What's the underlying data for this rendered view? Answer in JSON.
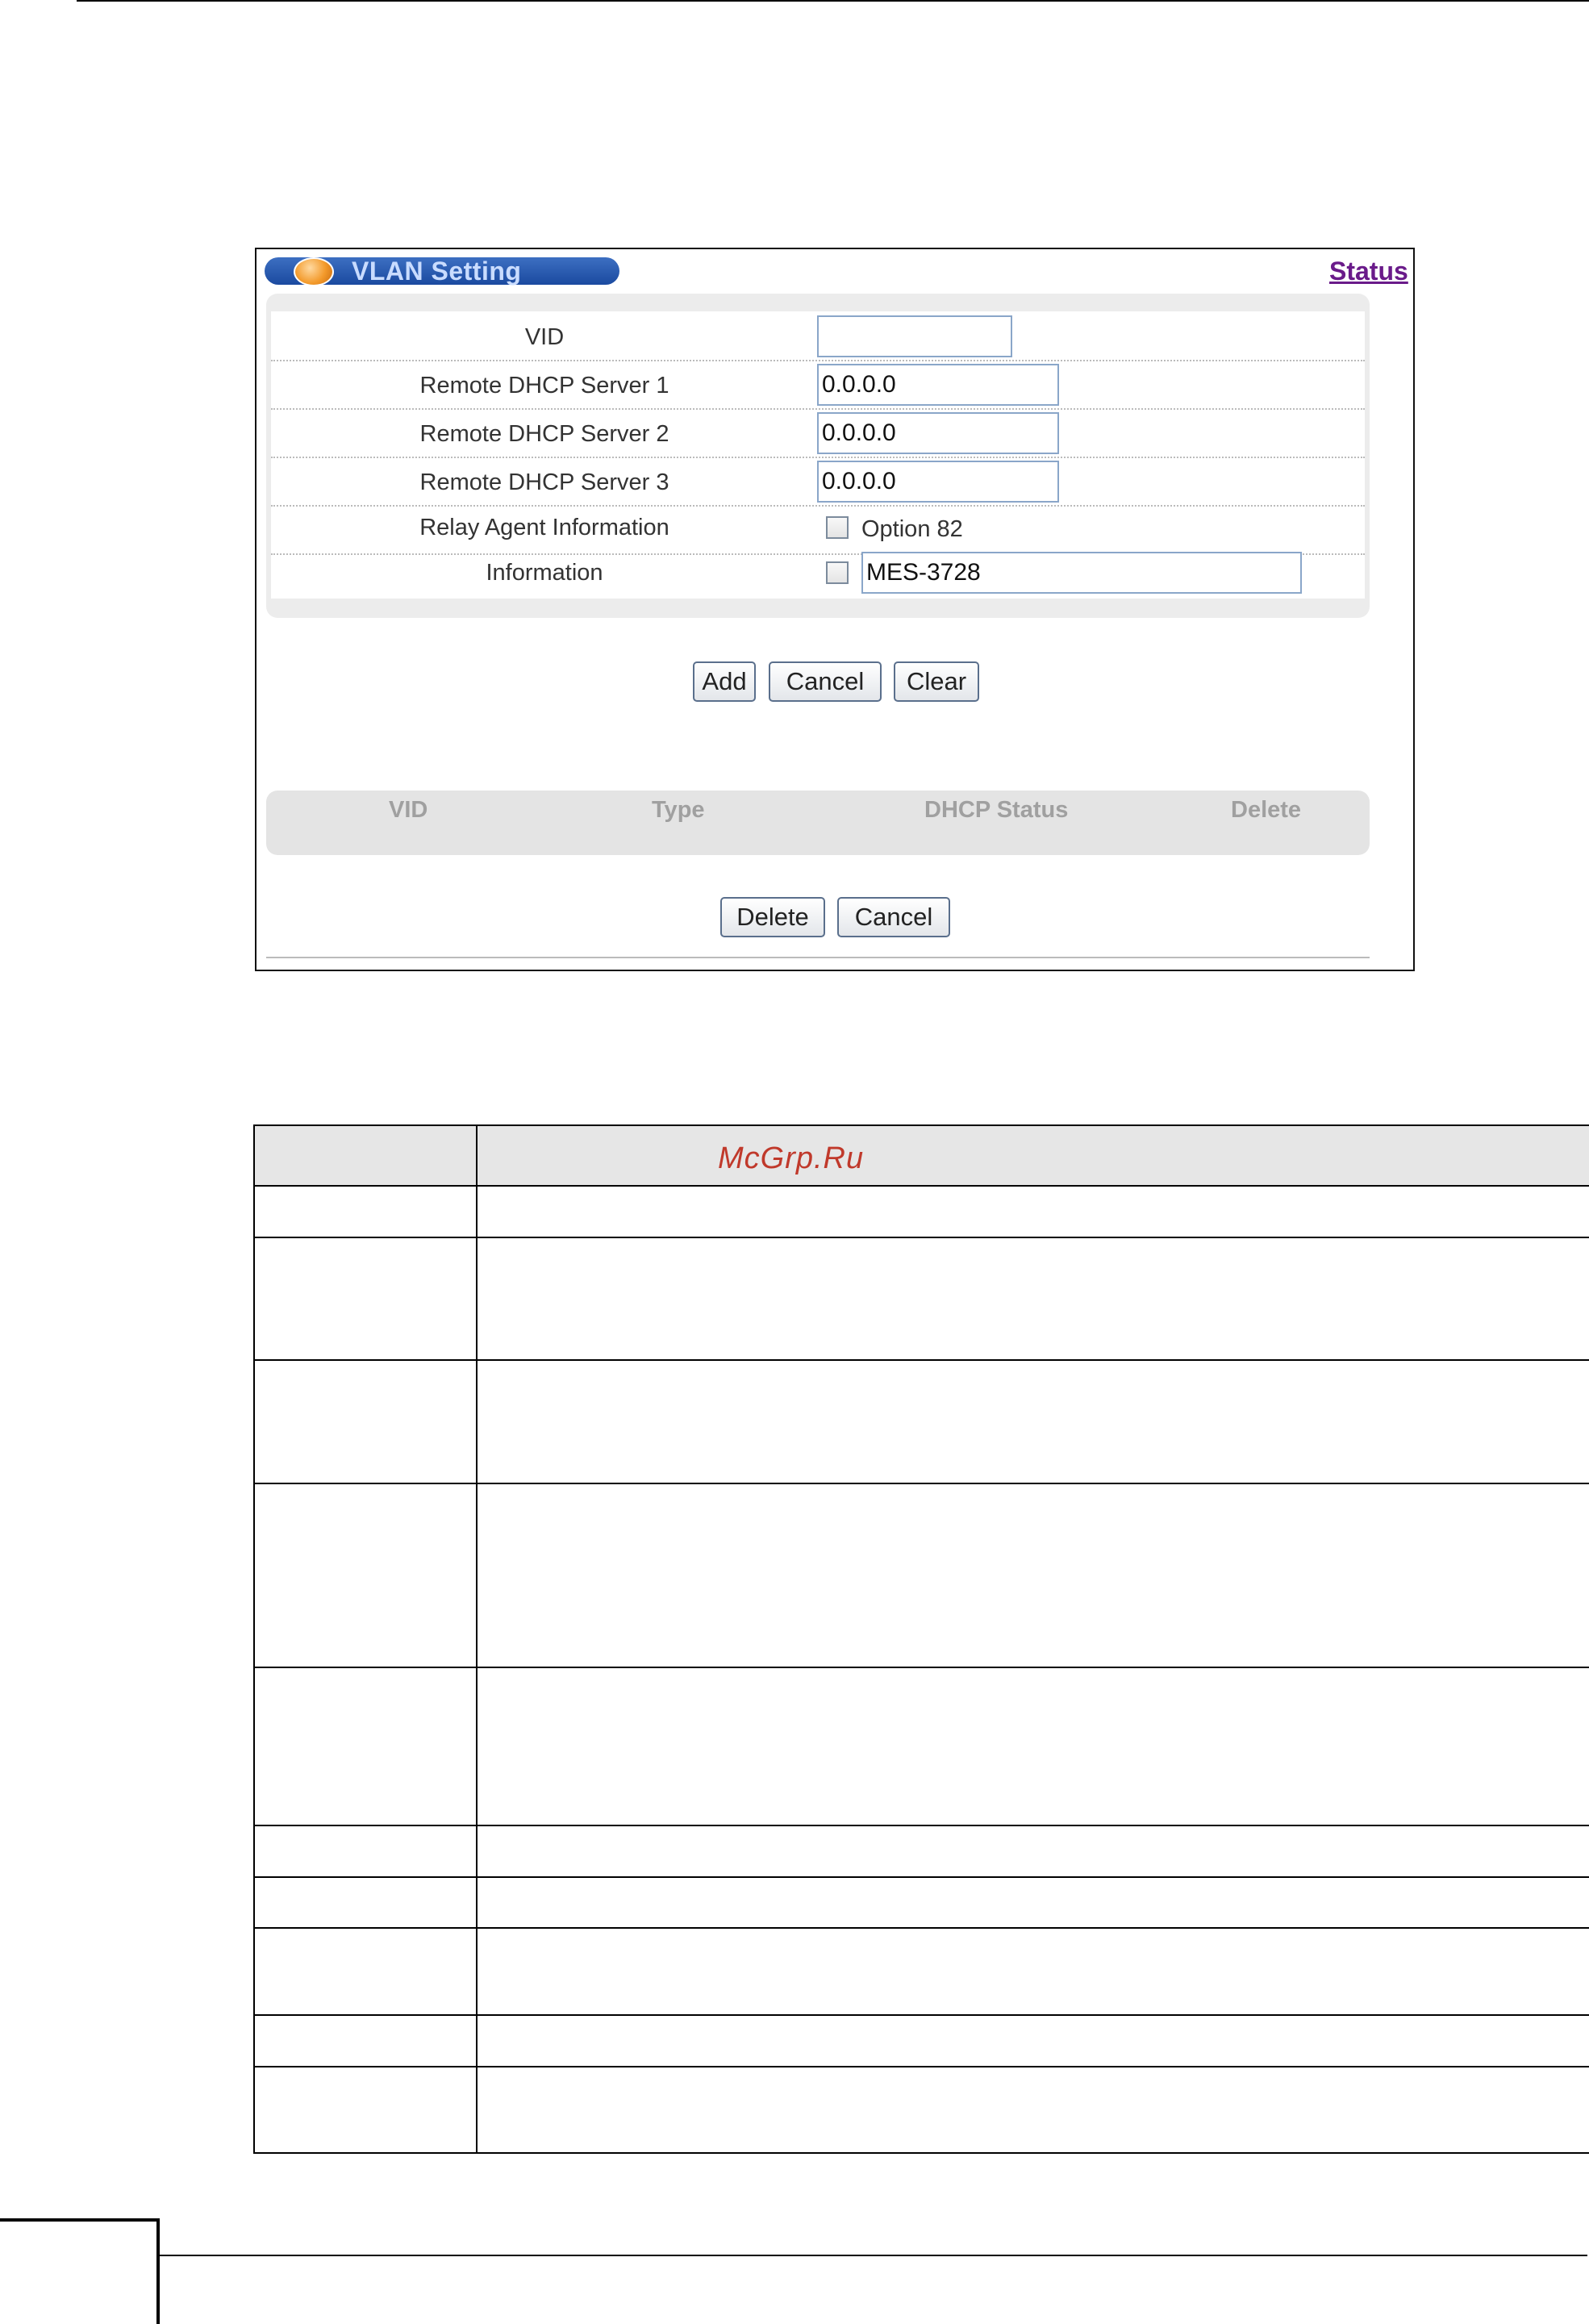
{
  "panel": {
    "title": "VLAN Setting",
    "status_link": "Status"
  },
  "form": {
    "vid_label": "VID",
    "vid_value": "",
    "dhcp1_label": "Remote DHCP Server 1",
    "dhcp1_value": "0.0.0.0",
    "dhcp2_label": "Remote DHCP Server 2",
    "dhcp2_value": "0.0.0.0",
    "dhcp3_label": "Remote DHCP Server 3",
    "dhcp3_value": "0.0.0.0",
    "relay_label": "Relay Agent Information",
    "option82_label": "Option 82",
    "option82_checked": false,
    "info_label": "Information",
    "info_checked": false,
    "info_value": "MES-3728"
  },
  "buttons": {
    "add": "Add",
    "cancel": "Cancel",
    "clear": "Clear",
    "delete": "Delete",
    "cancel2": "Cancel"
  },
  "list": {
    "columns": [
      "VID",
      "Type",
      "DHCP Status",
      "Delete"
    ]
  },
  "watermark": "McGrp.Ru"
}
